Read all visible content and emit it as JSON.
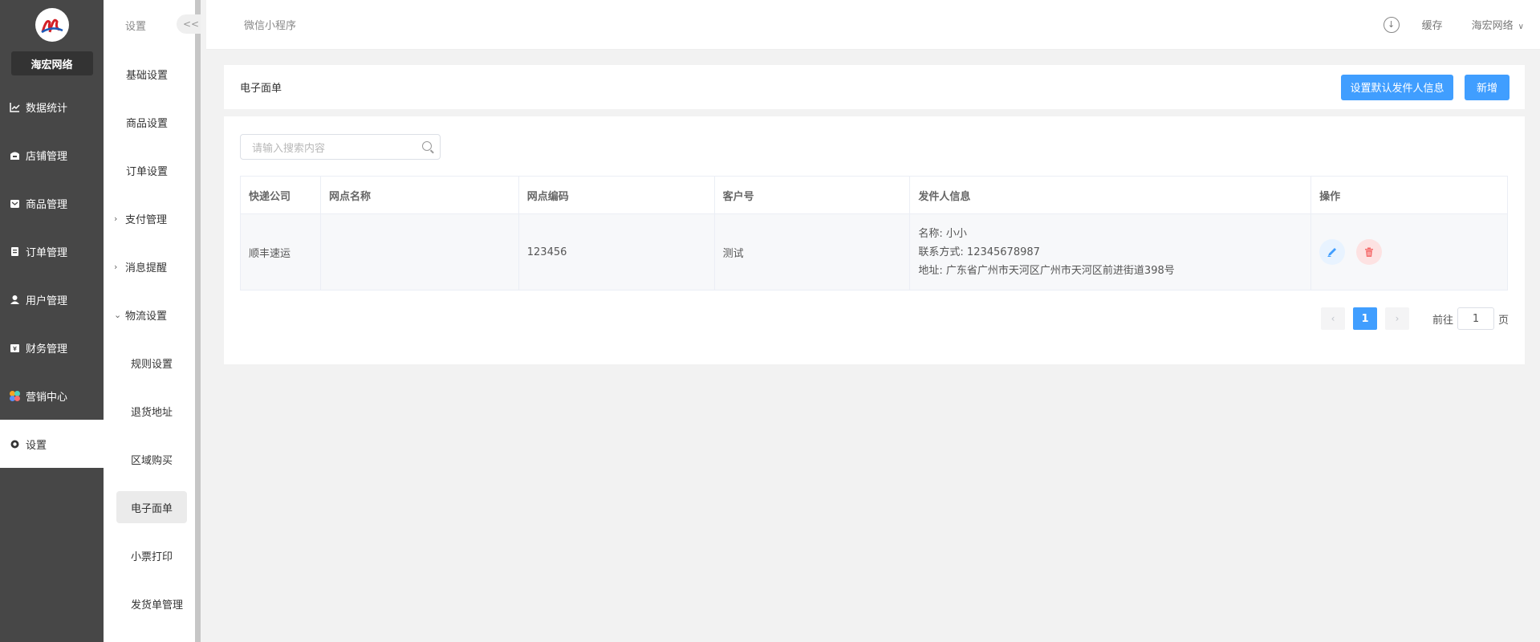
{
  "sidebar": {
    "brand": "海宏网络",
    "items": [
      {
        "label": "数据统计",
        "icon": "chart-icon"
      },
      {
        "label": "店铺管理",
        "icon": "store-icon"
      },
      {
        "label": "商品管理",
        "icon": "goods-icon"
      },
      {
        "label": "订单管理",
        "icon": "order-icon"
      },
      {
        "label": "用户管理",
        "icon": "user-icon"
      },
      {
        "label": "财务管理",
        "icon": "finance-icon"
      },
      {
        "label": "营销中心",
        "icon": "marketing-icon"
      },
      {
        "label": "设置",
        "icon": "settings-icon"
      }
    ]
  },
  "subnav": {
    "title": "设置",
    "collapse": "<<",
    "items": [
      "基础设置",
      "商品设置",
      "订单设置"
    ],
    "groups": {
      "payment": "支付管理",
      "message": "消息提醒",
      "logistics": "物流设置"
    },
    "logistics_children": [
      "规则设置",
      "退货地址",
      "区域购买",
      "电子面单",
      "小票打印",
      "发货单管理"
    ]
  },
  "topbar": {
    "title": "微信小程序",
    "cache": "缓存",
    "user": "海宏网络"
  },
  "page": {
    "title": "电子面单",
    "btn_default_sender": "设置默认发件人信息",
    "btn_add": "新增"
  },
  "search": {
    "placeholder": "请输入搜索内容"
  },
  "table": {
    "headers": [
      "快递公司",
      "网点名称",
      "网点编码",
      "客户号",
      "发件人信息",
      "操作"
    ],
    "rows": [
      {
        "company": "顺丰速运",
        "branch_name": "",
        "branch_code": "123456",
        "customer_no": "测试",
        "sender_name": "名称:  小小",
        "sender_phone": "联系方式:  12345678987",
        "sender_address": "地址:  广东省广州市天河区广州市天河区前进街道398号"
      }
    ]
  },
  "pagination": {
    "current": "1",
    "goto_label": "前往",
    "goto_value": "1",
    "page_suffix": "页"
  },
  "colors": {
    "primary": "#409eff",
    "sidebar_bg": "#474747",
    "danger": "#f56c6c"
  }
}
